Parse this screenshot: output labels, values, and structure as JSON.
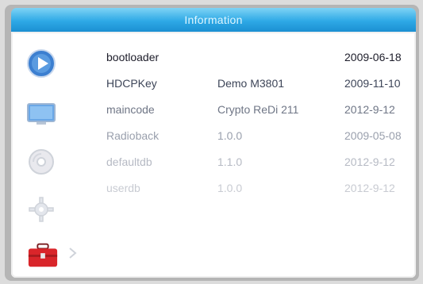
{
  "window": {
    "title": "Information"
  },
  "sidebar": {
    "icons": [
      "play-icon",
      "monitor-icon",
      "disc-icon",
      "gear-icon",
      "toolbox-icon"
    ],
    "selected": "toolbox-icon"
  },
  "info_table": [
    {
      "name": "bootloader",
      "version": "",
      "date": "2009-06-18"
    },
    {
      "name": "HDCPKey",
      "version": "Demo M3801",
      "date": "2009-11-10"
    },
    {
      "name": "maincode",
      "version": "Crypto ReDi 211",
      "date": "2012-9-12"
    },
    {
      "name": "Radioback",
      "version": "1.0.0",
      "date": "2009-05-08"
    },
    {
      "name": "defaultdb",
      "version": "1.1.0",
      "date": "2012-9-12"
    },
    {
      "name": "userdb",
      "version": "1.0.0",
      "date": "2012-9-12"
    }
  ],
  "colors": {
    "title_bar": "#2ea9e6",
    "accent_red": "#d9252a",
    "accent_blue": "#2f77c6"
  }
}
